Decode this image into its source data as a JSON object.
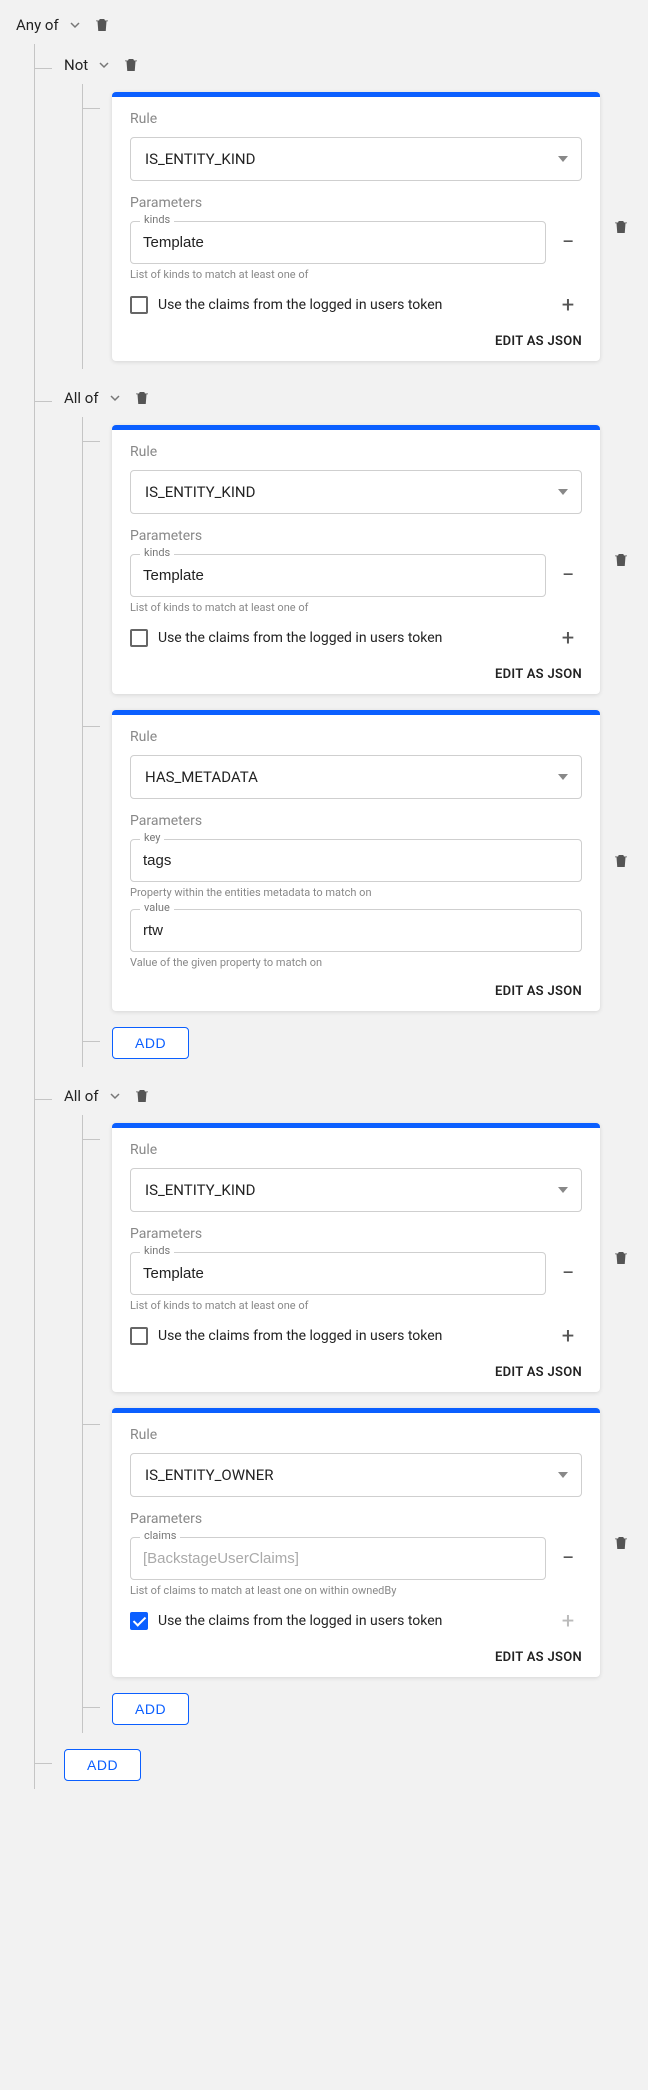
{
  "labels": {
    "rule": "Rule",
    "parameters": "Parameters",
    "claims_checkbox": "Use the claims from the logged in users token",
    "edit_as_json": "EDIT AS JSON",
    "add": "ADD",
    "helper_kinds": "List of kinds to match at least one of",
    "helper_key": "Property within the entities metadata to match on",
    "helper_value": "Value of the given property to match on",
    "helper_claims": "List of claims to match at least one on within ownedBy"
  },
  "ops": {
    "anyof": "Any of",
    "not": "Not",
    "allof": "All of"
  },
  "fields": {
    "kinds": "kinds",
    "key": "key",
    "value": "value",
    "claims": "claims",
    "claims_placeholder": "[BackstageUserClaims]"
  },
  "rules": {
    "not1_rule1": {
      "select": "IS_ENTITY_KIND",
      "kinds_value": "Template",
      "claims_checked": false
    },
    "all1_rule1": {
      "select": "IS_ENTITY_KIND",
      "kinds_value": "Template",
      "claims_checked": false
    },
    "all1_rule2": {
      "select": "HAS_METADATA",
      "key_value": "tags",
      "value_value": "rtw"
    },
    "all2_rule1": {
      "select": "IS_ENTITY_KIND",
      "kinds_value": "Template",
      "claims_checked": false
    },
    "all2_rule2": {
      "select": "IS_ENTITY_OWNER",
      "claims_value": "",
      "claims_checked": true
    }
  }
}
